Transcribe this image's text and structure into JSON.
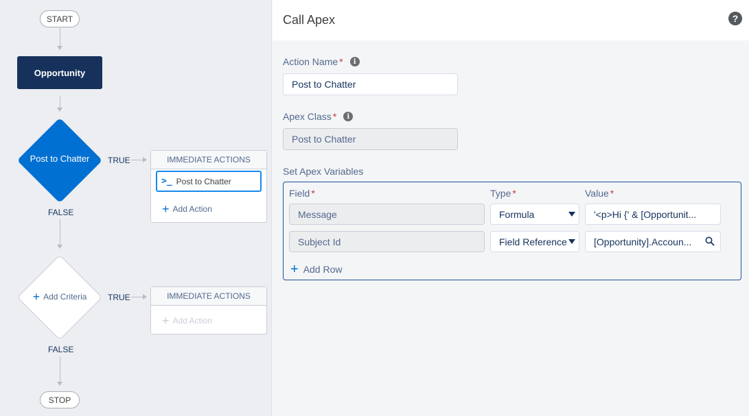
{
  "canvas": {
    "start_label": "START",
    "stop_label": "STOP",
    "object_label": "Opportunity",
    "criteria": [
      {
        "label": "Post to Chatter",
        "true_label": "TRUE",
        "false_label": "FALSE",
        "actions_header": "IMMEDIATE ACTIONS",
        "action_item": "Post to Chatter",
        "add_action": "Add Action"
      },
      {
        "label": "Add Criteria",
        "true_label": "TRUE",
        "false_label": "FALSE",
        "actions_header": "IMMEDIATE ACTIONS",
        "add_action": "Add Action"
      }
    ]
  },
  "panel": {
    "title": "Call Apex",
    "action_name": {
      "label": "Action Name",
      "value": "Post to Chatter"
    },
    "apex_class": {
      "label": "Apex Class",
      "value": "Post to Chatter"
    },
    "vars_label": "Set Apex Variables",
    "columns": {
      "field": "Field",
      "type": "Type",
      "value": "Value"
    },
    "rows": [
      {
        "field": "Message",
        "type": "Formula",
        "value": "'<p>Hi {' & [Opportunit..."
      },
      {
        "field": "Subject Id",
        "type": "Field Reference",
        "value": "[Opportunity].Accoun..."
      }
    ],
    "add_row": "Add Row",
    "required_marker": "*"
  },
  "colors": {
    "accent": "#0070d2",
    "navy": "#16325c",
    "required": "#c23934"
  }
}
